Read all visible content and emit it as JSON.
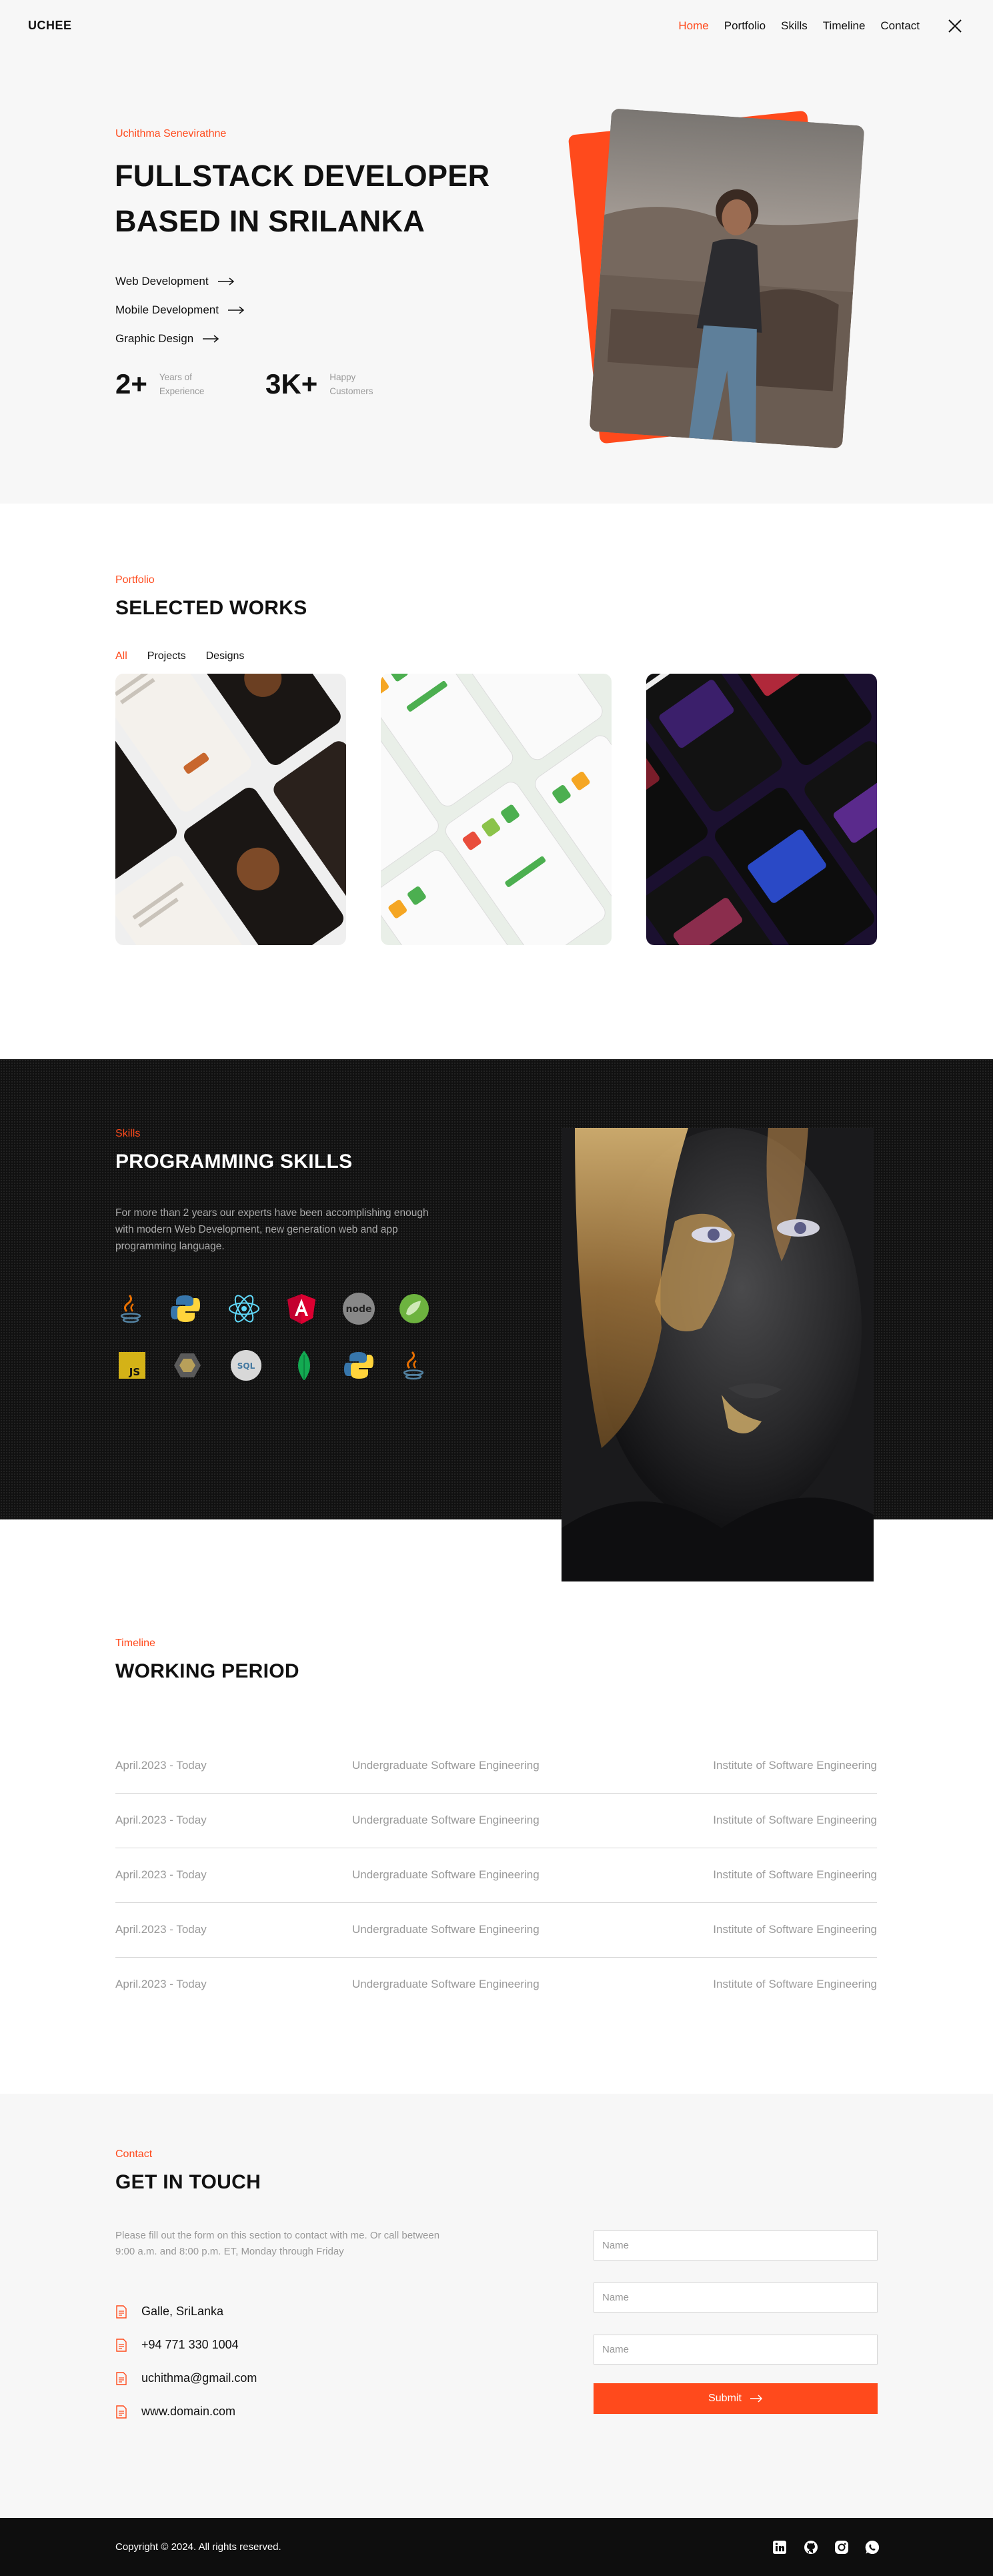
{
  "nav": {
    "logo": "UCHEE",
    "links": [
      "Home",
      "Portfolio",
      "Skills",
      "Timeline",
      "Contact"
    ],
    "active": "Home"
  },
  "hero": {
    "eyebrow": "Uchithma Senevirathne",
    "title_line1": "FULLSTACK DEVELOPER",
    "title_line2": "BASED IN SRILANKA",
    "services": [
      "Web Development",
      "Mobile Development",
      "Graphic Design"
    ],
    "stats": [
      {
        "num": "2+",
        "label_line1": "Years of",
        "label_line2": "Experience"
      },
      {
        "num": "3K+",
        "label_line1": "Happy",
        "label_line2": "Customers"
      }
    ]
  },
  "portfolio": {
    "eyebrow": "Portfolio",
    "title": "SELECTED WORKS",
    "tabs": [
      "All",
      "Projects",
      "Designs"
    ],
    "active_tab": "All"
  },
  "skills": {
    "eyebrow": "Skills",
    "title": "PROGRAMMING SKILLS",
    "description": "For more than 2 years our experts have been accomplishing enough with modern Web Development, new generation web and app programming language.",
    "icons": [
      "java-icon",
      "python-icon",
      "react-icon",
      "angular-icon",
      "nodejs-icon",
      "spring-icon",
      "javascript-icon",
      "kotlin-icon",
      "mysql-icon",
      "mongodb-icon",
      "python-icon",
      "java-icon"
    ]
  },
  "timeline": {
    "eyebrow": "Timeline",
    "title": "WORKING PERIOD",
    "rows": [
      {
        "period": "April.2023 - Today",
        "role": "Undergraduate Software Engineering",
        "org": "Institute of Software Engineering"
      },
      {
        "period": "April.2023 - Today",
        "role": "Undergraduate Software Engineering",
        "org": "Institute of Software Engineering"
      },
      {
        "period": "April.2023 - Today",
        "role": "Undergraduate Software Engineering",
        "org": "Institute of Software Engineering"
      },
      {
        "period": "April.2023 - Today",
        "role": "Undergraduate Software Engineering",
        "org": "Institute of Software Engineering"
      },
      {
        "period": "April.2023 - Today",
        "role": "Undergraduate Software Engineering",
        "org": "Institute of Software Engineering"
      }
    ]
  },
  "contact": {
    "eyebrow": "Contact",
    "title": "GET IN TOUCH",
    "description": "Please fill out the form on this section to contact with me. Or call between 9:00 a.m. and 8:00 p.m. ET, Monday through Friday",
    "items": [
      "Galle, SriLanka",
      "+94 771 330 1004",
      "uchithma@gmail.com",
      "www.domain.com"
    ],
    "fields": [
      {
        "placeholder": "Name",
        "value": ""
      },
      {
        "placeholder": "Name",
        "value": ""
      },
      {
        "placeholder": "Name",
        "value": ""
      }
    ],
    "submit_label": "Submit"
  },
  "footer": {
    "copyright": "Copyright © 2024. All rights reserved.",
    "social_icons": [
      "linkedin-icon",
      "github-icon",
      "instagram-icon",
      "whatsapp-icon"
    ]
  },
  "colors": {
    "accent": "#FF4A1C",
    "light_bg": "#F7F7F7",
    "dark_bg": "#111111"
  }
}
